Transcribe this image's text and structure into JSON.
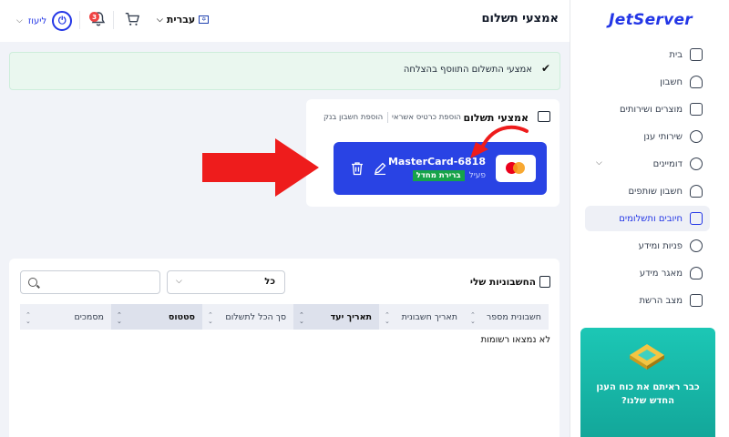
{
  "header": {
    "page_title": "אמצעי תשלום",
    "language": "עברית",
    "notifications_count": "3",
    "user_name": "ליעוז"
  },
  "alert": {
    "message": "אמצעי התשלום התווסף בהצלחה"
  },
  "payment_methods": {
    "title": "אמצעי תשלום",
    "add_card_label": "הוספת כרטיס אשראי",
    "add_bank_label": "הוספת חשבון בנק",
    "card": {
      "name": "MasterCard-6818",
      "status": "פעיל",
      "default_badge": "ברירת מחדל"
    }
  },
  "invoices": {
    "title": "החשבוניות שלי",
    "filter_value": "כל",
    "search_placeholder": "",
    "columns": [
      "חשבונית מספר",
      "תאריך חשבונית",
      "תאריך יעד",
      "סך הכל לתשלום",
      "סטטוס",
      "מסמכים"
    ],
    "empty_text": "לא נמצאו רשומות"
  },
  "sidebar": {
    "logo": "JetServer",
    "items": [
      {
        "label": "בית",
        "icon": "home-icon"
      },
      {
        "label": "חשבון",
        "icon": "user-icon"
      },
      {
        "label": "מוצרים ושירותים",
        "icon": "monitor-icon"
      },
      {
        "label": "שירותי ענן",
        "icon": "cloud-icon"
      },
      {
        "label": "דומיינים",
        "icon": "globe-icon"
      },
      {
        "label": "חשבון שותפים",
        "icon": "users-icon"
      },
      {
        "label": "חיובים ותשלומים",
        "icon": "billing-icon"
      },
      {
        "label": "פניות ומידע",
        "icon": "headset-icon"
      },
      {
        "label": "מאגר מידע",
        "icon": "lightbulb-icon"
      },
      {
        "label": "מצב הרשת",
        "icon": "chart-icon"
      }
    ],
    "promo_text": "כבר ראיתם את כוח הענן החדש שלנו?"
  },
  "colors": {
    "brand": "#2336e6",
    "card_bg": "#2943e4",
    "success": "#16a34a",
    "promo": "#1cc7b5",
    "annotation_arrow": "#ee1c1c"
  }
}
